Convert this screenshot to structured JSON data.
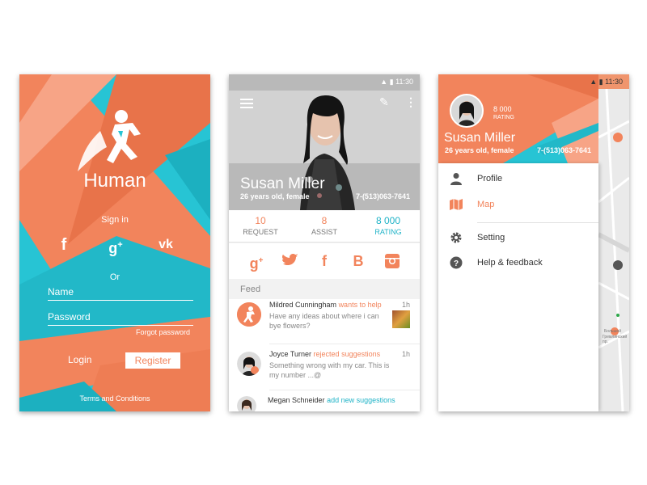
{
  "colors": {
    "accent": "#f2845c",
    "teal": "#27c4d4",
    "teal_text": "#1fb3c7",
    "white": "#ffffff"
  },
  "login": {
    "app_name": "Human",
    "sign_in_label": "Sign in",
    "social": [
      {
        "icon": "facebook-icon",
        "glyph": "f"
      },
      {
        "icon": "google-plus-icon",
        "glyph": "g+"
      },
      {
        "icon": "vk-icon",
        "glyph": "vk"
      }
    ],
    "or_label": "Or",
    "name_placeholder": "Name",
    "password_placeholder": "Password",
    "forgot_password": "Forgot password",
    "login_label": "Login",
    "register_label": "Register",
    "terms": "Terms and Conditions"
  },
  "profile": {
    "status_time": "11:30",
    "name": "Susan Miller",
    "subtitle": "26 years old, female",
    "phone": "7-(513)063-7641",
    "stats": [
      {
        "value": "10",
        "label": "REQUEST"
      },
      {
        "value": "8",
        "label": "ASSIST"
      },
      {
        "value": "8 000",
        "label": "RATING"
      }
    ],
    "share": [
      {
        "icon": "google-plus-icon",
        "glyph": "g+"
      },
      {
        "icon": "twitter-icon",
        "glyph": "t"
      },
      {
        "icon": "facebook-icon",
        "glyph": "f"
      },
      {
        "icon": "b-icon",
        "glyph": "B"
      },
      {
        "icon": "instagram-icon",
        "glyph": "ig"
      }
    ],
    "feed_title": "Feed",
    "feed": [
      {
        "name": "Mildred Cunningham",
        "action": "wants to help",
        "message": "Have any ideas about where i can bye flowers?",
        "time": "1h"
      },
      {
        "name": "Joyce Turner",
        "action": "rejected suggestions",
        "message": "Something wrong with my car. This is my number ...@",
        "time": "1h"
      },
      {
        "name": "Megan Schneider",
        "action": "add new suggestions",
        "message": "",
        "time": ""
      }
    ]
  },
  "drawer": {
    "status_time": "11:30",
    "rating_value": "8 000",
    "rating_label": "RATING",
    "name": "Susan Miller",
    "subtitle": "26 years old, female",
    "phone": "7-(513)063-7641",
    "menu": [
      {
        "label": "Profile",
        "icon": "person-icon"
      },
      {
        "label": "Map",
        "icon": "map-icon"
      },
      {
        "label": "Setting",
        "icon": "gear-icon"
      },
      {
        "label": "Help & feedback",
        "icon": "help-icon"
      }
    ],
    "map_label_1": "Большой",
    "map_label_2": "Гремлинский пр."
  }
}
